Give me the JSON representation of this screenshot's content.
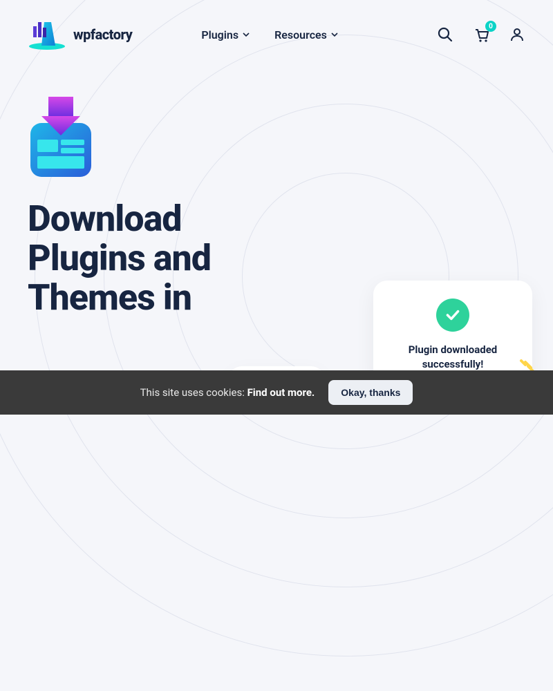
{
  "brand": {
    "name": "wpfactory"
  },
  "nav": {
    "items": [
      {
        "label": "Plugins"
      },
      {
        "label": "Resources"
      }
    ]
  },
  "cart": {
    "count": "0"
  },
  "hero": {
    "title": "Download Plugins and Themes in"
  },
  "card": {
    "line1": "Plugin downloaded",
    "line2": "successfully!"
  },
  "cookie": {
    "prefix": "This site uses cookies: ",
    "link": "Find out more.",
    "button": "Okay, thanks"
  }
}
